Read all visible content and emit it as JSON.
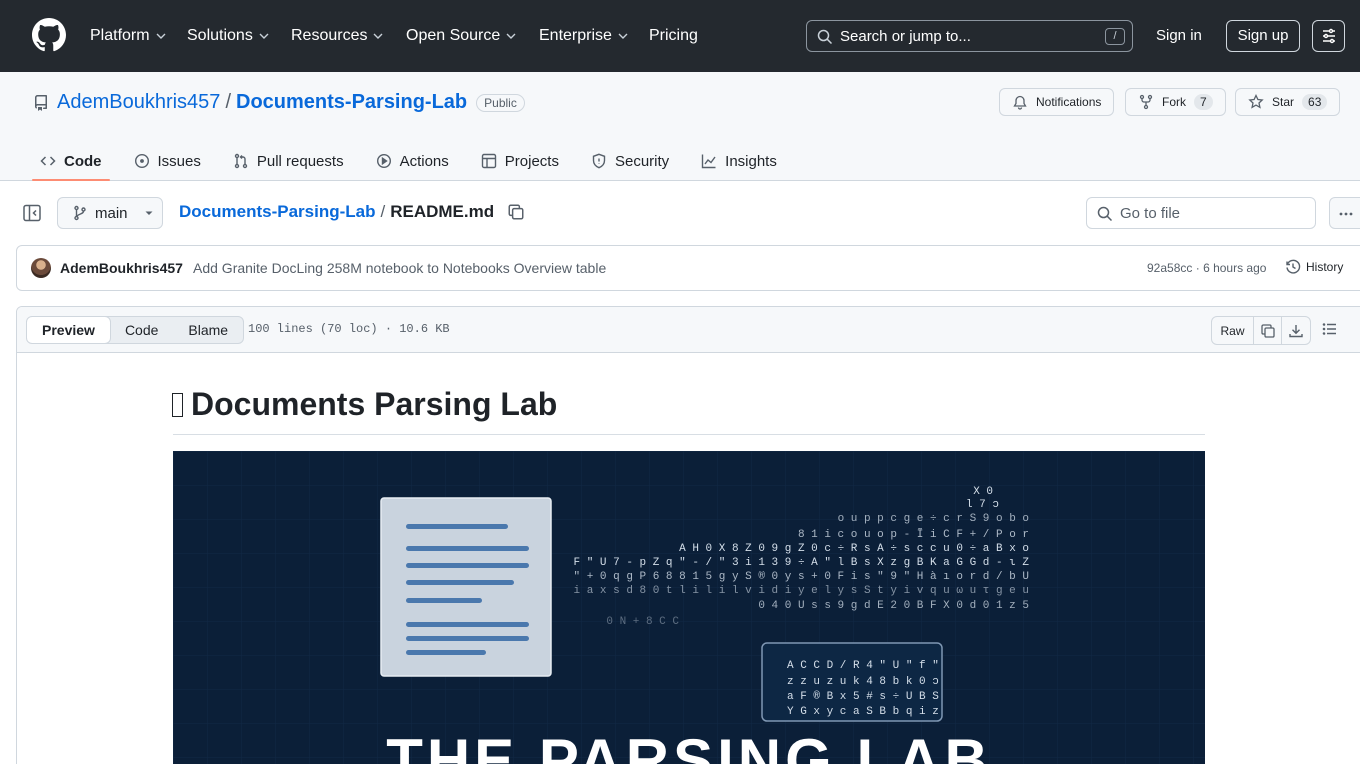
{
  "header": {
    "nav": [
      {
        "label": "Platform",
        "dropdown": true
      },
      {
        "label": "Solutions",
        "dropdown": true
      },
      {
        "label": "Resources",
        "dropdown": true
      },
      {
        "label": "Open Source",
        "dropdown": true
      },
      {
        "label": "Enterprise",
        "dropdown": true
      },
      {
        "label": "Pricing",
        "dropdown": false
      }
    ],
    "search_placeholder": "Search or jump to...",
    "search_shortcut": "/",
    "sign_in": "Sign in",
    "sign_up": "Sign up"
  },
  "repo": {
    "owner": "AdemBoukhris457",
    "separator": "/",
    "name": "Documents-Parsing-Lab",
    "visibility": "Public",
    "notifications_label": "Notifications",
    "fork_label": "Fork",
    "fork_count": "7",
    "star_label": "Star",
    "star_count": "63",
    "tabs": [
      {
        "label": "Code",
        "icon": "code-icon"
      },
      {
        "label": "Issues",
        "icon": "issue-icon"
      },
      {
        "label": "Pull requests",
        "icon": "pull-request-icon"
      },
      {
        "label": "Actions",
        "icon": "play-icon"
      },
      {
        "label": "Projects",
        "icon": "table-icon"
      },
      {
        "label": "Security",
        "icon": "shield-icon"
      },
      {
        "label": "Insights",
        "icon": "graph-icon"
      }
    ]
  },
  "file_nav": {
    "branch": "main",
    "repo_link": "Documents-Parsing-Lab",
    "separator": "/",
    "file_name": "README.md",
    "goto_placeholder": "Go to file"
  },
  "commit": {
    "author": "AdemBoukhris457",
    "message": "Add Granite DocLing 258M notebook to Notebooks Overview table",
    "sha": "92a58cc",
    "dot": "·",
    "time": "6 hours ago",
    "history_label": "History"
  },
  "file_view": {
    "modes": [
      "Preview",
      "Code",
      "Blame"
    ],
    "active_mode": "Preview",
    "info": "100 lines (70 loc) · 10.6 KB",
    "raw_label": "Raw"
  },
  "readme": {
    "title": "Documents Parsing Lab",
    "banner_title": "THE PARSING LAB",
    "banner_stream": [
      "X 0",
      "l 7 ɔ",
      "o u   p p c g e ÷ c r S 9 o b o",
      "8 1   i c o u o p - Ĩ i C F + / P o r",
      "A H  0 X 8 Z 0 9 g Z 0 c ÷ R s A ÷ s c c u 0 ÷ a B x o",
      "F  \"  U  7 - p Z q  \" - / \" 3 i 1 3 9 ÷ A \" l B s X z g B K a G G d - ι Z",
      "\" + 0 q g P  6 8 8 1 5 g y S ® 0 y s + 0 F i s \" 9 \" H à ı o r d / b U",
      "i a x s d 8 0 t l i l i l v i d i y e l y s S t y i v q u ω u τ g e u",
      "0 4   0 U               s s 9 g d E 2 0 B F X 0 d 0 1 z   5",
      "0 N + 8 C C"
    ],
    "banner_box": [
      "A C C D / R 4 \" U \" f \"",
      "z z u z u k 4 8 b k 0 ɔ",
      "a F ® B x 5 # s ÷ U B S",
      "Y G x y c a S B b q i z"
    ]
  }
}
